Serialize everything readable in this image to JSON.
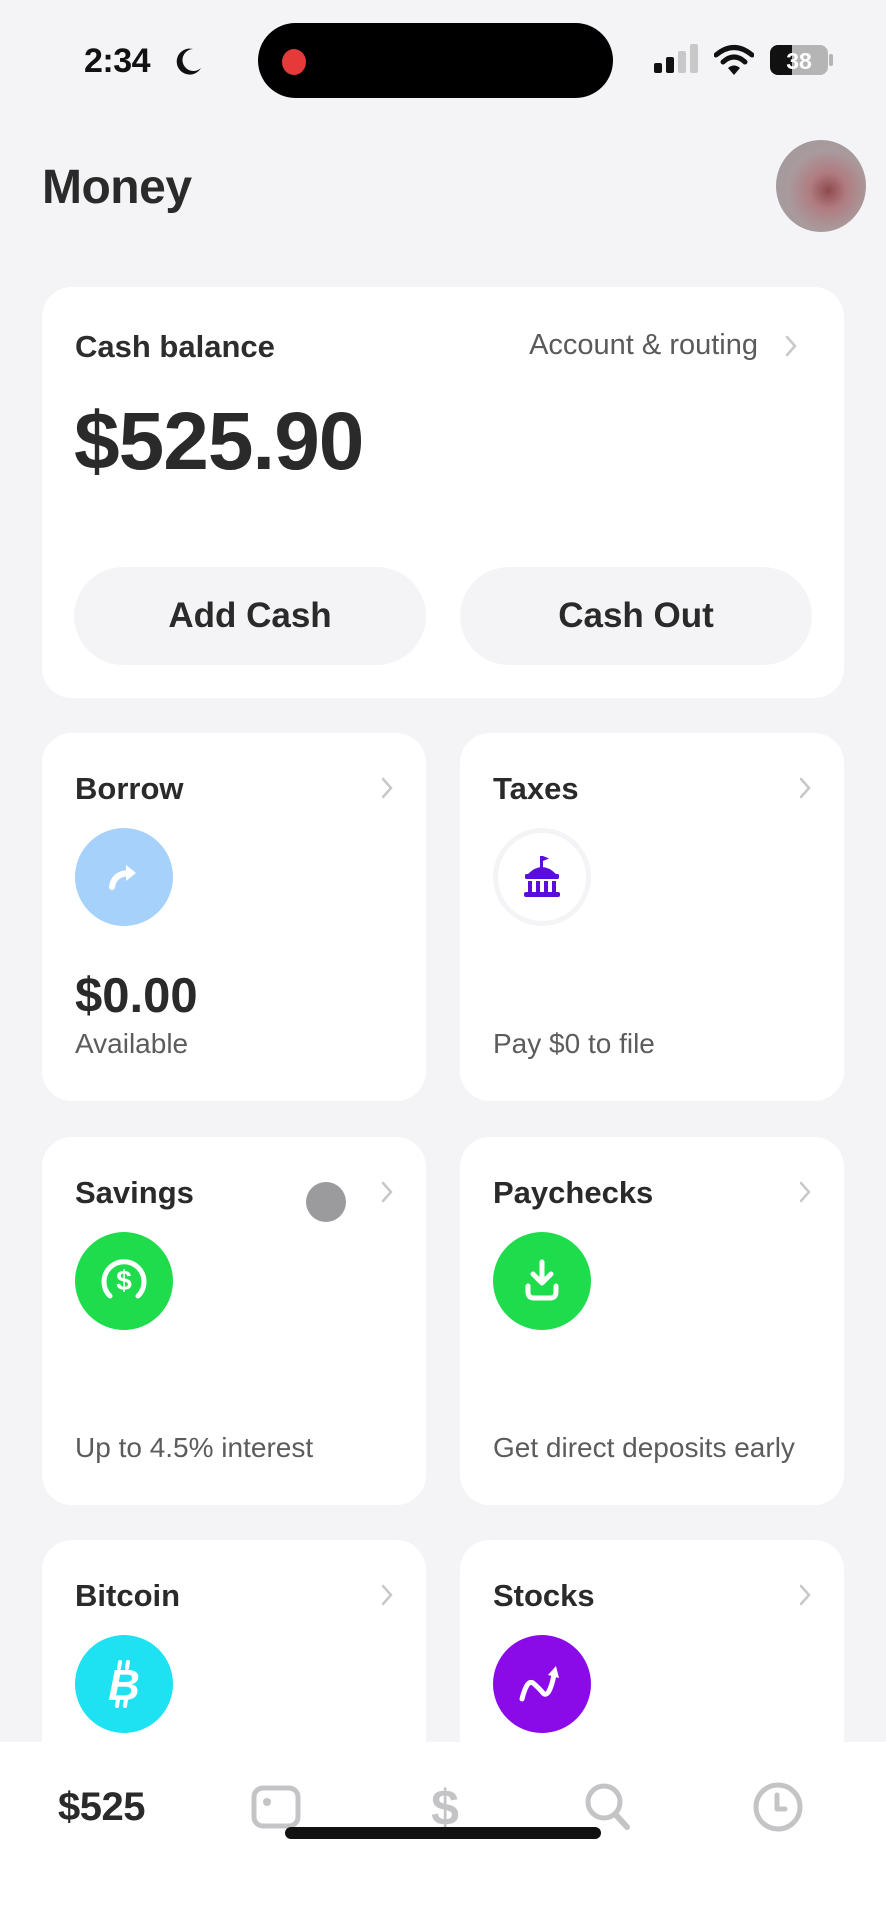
{
  "status_bar": {
    "time": "2:34",
    "focus_icon": "moon-icon",
    "battery_level": "38",
    "recording_indicator": true
  },
  "header": {
    "title": "Money",
    "avatar_icon": "profile-avatar"
  },
  "cash_card": {
    "label": "Cash balance",
    "account_link": "Account & routing",
    "balance": "$525.90",
    "add_cash": "Add Cash",
    "cash_out": "Cash Out"
  },
  "tiles": [
    {
      "title": "Borrow",
      "icon": "curved-arrow-icon",
      "icon_color": "#a6d1fa",
      "amount": "$0.00",
      "subtitle": "Available"
    },
    {
      "title": "Taxes",
      "icon": "capitol-building-icon",
      "icon_color": "#5b0edb",
      "subtitle": "Pay $0 to file"
    },
    {
      "title": "Savings",
      "icon": "savings-dollar-icon",
      "icon_color": "#1edc4c",
      "subtitle": "Up to 4.5% interest"
    },
    {
      "title": "Paychecks",
      "icon": "download-tray-icon",
      "icon_color": "#1edc4c",
      "subtitle": "Get direct deposits early"
    },
    {
      "title": "Bitcoin",
      "icon": "bitcoin-icon",
      "icon_color": "#1ee1f2"
    },
    {
      "title": "Stocks",
      "icon": "trend-arrow-icon",
      "icon_color": "#8a0be8"
    }
  ],
  "tab_bar": {
    "balance_label": "$525",
    "tabs": [
      "money",
      "card",
      "pay",
      "search",
      "activity"
    ]
  },
  "colors": {
    "background": "#f4f4f6",
    "card": "#ffffff",
    "text_primary": "#2a2a2a",
    "text_secondary": "#5c5c5c",
    "inactive_tab": "#c4c4c6"
  }
}
